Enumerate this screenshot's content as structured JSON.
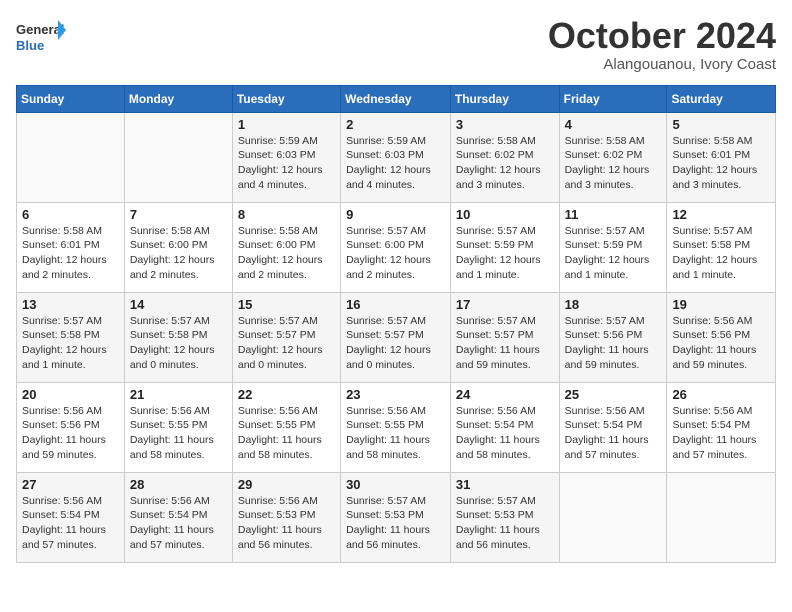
{
  "header": {
    "logo_line1": "General",
    "logo_line2": "Blue",
    "month": "October 2024",
    "location": "Alangouanou, Ivory Coast"
  },
  "weekdays": [
    "Sunday",
    "Monday",
    "Tuesday",
    "Wednesday",
    "Thursday",
    "Friday",
    "Saturday"
  ],
  "weeks": [
    [
      {
        "day": "",
        "info": ""
      },
      {
        "day": "",
        "info": ""
      },
      {
        "day": "1",
        "info": "Sunrise: 5:59 AM\nSunset: 6:03 PM\nDaylight: 12 hours and 4 minutes."
      },
      {
        "day": "2",
        "info": "Sunrise: 5:59 AM\nSunset: 6:03 PM\nDaylight: 12 hours and 4 minutes."
      },
      {
        "day": "3",
        "info": "Sunrise: 5:58 AM\nSunset: 6:02 PM\nDaylight: 12 hours and 3 minutes."
      },
      {
        "day": "4",
        "info": "Sunrise: 5:58 AM\nSunset: 6:02 PM\nDaylight: 12 hours and 3 minutes."
      },
      {
        "day": "5",
        "info": "Sunrise: 5:58 AM\nSunset: 6:01 PM\nDaylight: 12 hours and 3 minutes."
      }
    ],
    [
      {
        "day": "6",
        "info": "Sunrise: 5:58 AM\nSunset: 6:01 PM\nDaylight: 12 hours and 2 minutes."
      },
      {
        "day": "7",
        "info": "Sunrise: 5:58 AM\nSunset: 6:00 PM\nDaylight: 12 hours and 2 minutes."
      },
      {
        "day": "8",
        "info": "Sunrise: 5:58 AM\nSunset: 6:00 PM\nDaylight: 12 hours and 2 minutes."
      },
      {
        "day": "9",
        "info": "Sunrise: 5:57 AM\nSunset: 6:00 PM\nDaylight: 12 hours and 2 minutes."
      },
      {
        "day": "10",
        "info": "Sunrise: 5:57 AM\nSunset: 5:59 PM\nDaylight: 12 hours and 1 minute."
      },
      {
        "day": "11",
        "info": "Sunrise: 5:57 AM\nSunset: 5:59 PM\nDaylight: 12 hours and 1 minute."
      },
      {
        "day": "12",
        "info": "Sunrise: 5:57 AM\nSunset: 5:58 PM\nDaylight: 12 hours and 1 minute."
      }
    ],
    [
      {
        "day": "13",
        "info": "Sunrise: 5:57 AM\nSunset: 5:58 PM\nDaylight: 12 hours and 1 minute."
      },
      {
        "day": "14",
        "info": "Sunrise: 5:57 AM\nSunset: 5:58 PM\nDaylight: 12 hours and 0 minutes."
      },
      {
        "day": "15",
        "info": "Sunrise: 5:57 AM\nSunset: 5:57 PM\nDaylight: 12 hours and 0 minutes."
      },
      {
        "day": "16",
        "info": "Sunrise: 5:57 AM\nSunset: 5:57 PM\nDaylight: 12 hours and 0 minutes."
      },
      {
        "day": "17",
        "info": "Sunrise: 5:57 AM\nSunset: 5:57 PM\nDaylight: 11 hours and 59 minutes."
      },
      {
        "day": "18",
        "info": "Sunrise: 5:57 AM\nSunset: 5:56 PM\nDaylight: 11 hours and 59 minutes."
      },
      {
        "day": "19",
        "info": "Sunrise: 5:56 AM\nSunset: 5:56 PM\nDaylight: 11 hours and 59 minutes."
      }
    ],
    [
      {
        "day": "20",
        "info": "Sunrise: 5:56 AM\nSunset: 5:56 PM\nDaylight: 11 hours and 59 minutes."
      },
      {
        "day": "21",
        "info": "Sunrise: 5:56 AM\nSunset: 5:55 PM\nDaylight: 11 hours and 58 minutes."
      },
      {
        "day": "22",
        "info": "Sunrise: 5:56 AM\nSunset: 5:55 PM\nDaylight: 11 hours and 58 minutes."
      },
      {
        "day": "23",
        "info": "Sunrise: 5:56 AM\nSunset: 5:55 PM\nDaylight: 11 hours and 58 minutes."
      },
      {
        "day": "24",
        "info": "Sunrise: 5:56 AM\nSunset: 5:54 PM\nDaylight: 11 hours and 58 minutes."
      },
      {
        "day": "25",
        "info": "Sunrise: 5:56 AM\nSunset: 5:54 PM\nDaylight: 11 hours and 57 minutes."
      },
      {
        "day": "26",
        "info": "Sunrise: 5:56 AM\nSunset: 5:54 PM\nDaylight: 11 hours and 57 minutes."
      }
    ],
    [
      {
        "day": "27",
        "info": "Sunrise: 5:56 AM\nSunset: 5:54 PM\nDaylight: 11 hours and 57 minutes."
      },
      {
        "day": "28",
        "info": "Sunrise: 5:56 AM\nSunset: 5:54 PM\nDaylight: 11 hours and 57 minutes."
      },
      {
        "day": "29",
        "info": "Sunrise: 5:56 AM\nSunset: 5:53 PM\nDaylight: 11 hours and 56 minutes."
      },
      {
        "day": "30",
        "info": "Sunrise: 5:57 AM\nSunset: 5:53 PM\nDaylight: 11 hours and 56 minutes."
      },
      {
        "day": "31",
        "info": "Sunrise: 5:57 AM\nSunset: 5:53 PM\nDaylight: 11 hours and 56 minutes."
      },
      {
        "day": "",
        "info": ""
      },
      {
        "day": "",
        "info": ""
      }
    ]
  ]
}
